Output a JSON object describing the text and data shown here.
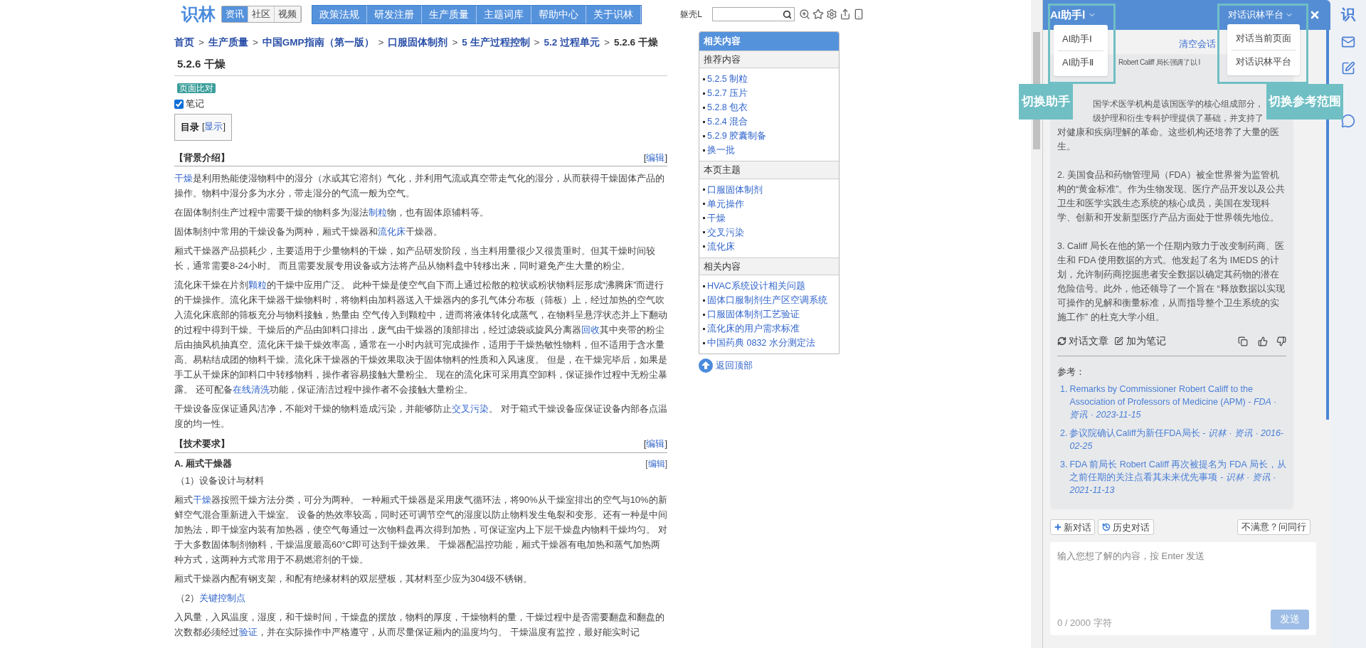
{
  "header": {
    "logo": "识林",
    "site_tabs": [
      {
        "label": "资讯",
        "selected": true
      },
      {
        "label": "社区",
        "selected": false
      },
      {
        "label": "视频",
        "selected": false
      }
    ],
    "nav_menu": [
      "政策法规",
      "研发注册",
      "生产质量",
      "主题词库",
      "帮助中心",
      "关于识林"
    ],
    "user": "躯壳L"
  },
  "breadcrumb": [
    {
      "kind": "link",
      "text": "首页"
    },
    {
      "kind": "sep",
      "text": ">"
    },
    {
      "kind": "link",
      "text": "生产质量"
    },
    {
      "kind": "sep",
      "text": ">"
    },
    {
      "kind": "link",
      "text": "中国GMP指南（第一版）"
    },
    {
      "kind": "sep",
      "text": ">"
    },
    {
      "kind": "link",
      "text": "口服固体制剂"
    },
    {
      "kind": "sep",
      "text": ">"
    },
    {
      "kind": "link",
      "text": "5 生产过程控制"
    },
    {
      "kind": "sep",
      "text": ">"
    },
    {
      "kind": "link",
      "text": "5.2 过程单元"
    },
    {
      "kind": "sep",
      "text": ">"
    },
    {
      "kind": "current",
      "text": "5.2.6 干燥"
    }
  ],
  "article": {
    "title": "5.2.6 干燥",
    "compare_badge": "页面比对",
    "note_checkbox": {
      "label": "笔记",
      "checked": true
    },
    "toc": {
      "title": "目录",
      "toggle": [
        {
          "kind": "text",
          "text": "["
        },
        {
          "kind": "link",
          "text": "显示"
        },
        {
          "kind": "text",
          "text": "]"
        }
      ]
    },
    "sections": [
      {
        "kind": "section",
        "title": "【背景介绍】",
        "edit": [
          {
            "kind": "text",
            "text": "["
          },
          {
            "kind": "link",
            "text": "编辑"
          },
          {
            "kind": "text",
            "text": "]"
          }
        ]
      },
      {
        "kind": "paragraph",
        "segments": [
          {
            "kind": "link",
            "text": "干燥"
          },
          {
            "kind": "text",
            "text": "是利用热能使湿物料中的湿分（水或其它溶剂）气化，并利用气流或真空带走气化的湿分，从而获得干燥固体产品的操作。物料中湿分多为水分，带走湿分的气流一般为空气。"
          }
        ]
      },
      {
        "kind": "paragraph",
        "segments": [
          {
            "kind": "text",
            "text": "在固体制剂生产过程中需要干燥的物料多为湿法"
          },
          {
            "kind": "link",
            "text": "制粒"
          },
          {
            "kind": "text",
            "text": "物，也有固体原辅料等。"
          }
        ]
      },
      {
        "kind": "paragraph",
        "segments": [
          {
            "kind": "text",
            "text": "固体制剂中常用的干燥设备为两种，厢式干燥器和"
          },
          {
            "kind": "link",
            "text": "流化床"
          },
          {
            "kind": "text",
            "text": "干燥器。"
          }
        ]
      },
      {
        "kind": "paragraph",
        "segments": [
          {
            "kind": "text",
            "text": "厢式干燥器产品损耗少，主要适用于少量物料的干燥，如产品研发阶段，当主料用量很少又很贵重时。但其干燥时间较长，通常需要8-24小时。 而且需要发展专用设备或方法将产品从物料盘中转移出来，同时避免产生大量的粉尘。"
          }
        ]
      },
      {
        "kind": "paragraph",
        "segments": [
          {
            "kind": "text",
            "text": "流化床干燥在片剂"
          },
          {
            "kind": "link",
            "text": "颗粒"
          },
          {
            "kind": "text",
            "text": "的干燥中应用广泛。 此种干燥是使空气自下而上通过松散的粒状或粉状物料层形成“沸腾床”而进行的干燥操作。流化床干燥器干燥物料时，将物料由加料器送入干燥器内的多孔气体分布板（筛板）上，经过加热的空气吹入流化床底部的筛板充分与物料接触，热量由 空气传入到颗粒中，进而将液体转化成蒸气，在物料呈悬浮状态并上下翻动的过程中得到干燥。干燥后的产品由卸料口排出，废气由干燥器的顶部排出，经过滤袋或旋风分离器"
          },
          {
            "kind": "link",
            "text": "回收"
          },
          {
            "kind": "text",
            "text": "其中夹带的粉尘后由抽风机抽真空。流化床干燥干燥效率高，通常在一小时内就可完成操作，适用于干燥热敏性物料，但不适用于含水量高、易粘结成团的物料干燥。流化床干燥器的干燥效果取决于固体物料的性质和入风速度。 但是，在干燥完毕后，如果是手工从干燥床的卸料口中转移物料，操作者容易接触大量粉尘。 现在的流化床可采用真空卸料，保证操作过程中无粉尘暴露。 还可配备"
          },
          {
            "kind": "link",
            "text": "在线清洗"
          },
          {
            "kind": "text",
            "text": "功能，保证清洁过程中操作者不会接触大量粉尘。"
          }
        ]
      },
      {
        "kind": "paragraph",
        "segments": [
          {
            "kind": "text",
            "text": "干燥设备应保证通风洁净，不能对干燥的物料造成污染，并能够防止"
          },
          {
            "kind": "link",
            "text": "交叉污染"
          },
          {
            "kind": "text",
            "text": "。 对于箱式干燥设备应保证设备内部各点温度的均一性。"
          }
        ]
      },
      {
        "kind": "section",
        "title": "【技术要求】",
        "edit": [
          {
            "kind": "text",
            "text": "["
          },
          {
            "kind": "link",
            "text": "编辑"
          },
          {
            "kind": "text",
            "text": "]"
          }
        ]
      },
      {
        "kind": "subsection",
        "title": "A. 厢式干燥器",
        "edit": [
          {
            "kind": "text",
            "text": "["
          },
          {
            "kind": "link",
            "text": "编辑"
          },
          {
            "kind": "text",
            "text": "]"
          }
        ]
      },
      {
        "kind": "item",
        "segments": [
          {
            "kind": "text",
            "text": "（1）设备设计与材料"
          }
        ]
      },
      {
        "kind": "paragraph",
        "segments": [
          {
            "kind": "text",
            "text": "厢式"
          },
          {
            "kind": "link",
            "text": "干燥"
          },
          {
            "kind": "text",
            "text": "器按照干燥方法分类，可分为两种。 一种厢式干燥器是采用废气循环法，将90%从干燥室排出的空气与10%的新鲜空气混合重新进入干燥室。 设备的热效率较高，同时还可调节空气的湿度以防止物料发生龟裂和变形。还有一种是中间加热法，即干燥室内装有加热器，使空气每通过一次物料盘再次得到加热，可保证室内上下层干燥盘内物料干燥均匀。 对于大多数固体制剂物料，干燥温度最高60°C即可达到干燥效果。 干燥器配温控功能，厢式干燥器有电加热和蒸气加热两种方式，这两种方式常用于不易燃溶剂的干燥。"
          }
        ]
      },
      {
        "kind": "paragraph",
        "segments": [
          {
            "kind": "text",
            "text": "厢式干燥器内配有钢支架，和配有绝缘材料的双层壁板，其材料至少应为304级不锈钢。"
          }
        ]
      },
      {
        "kind": "item",
        "segments": [
          {
            "kind": "text",
            "text": "（2）"
          },
          {
            "kind": "link",
            "text": "关键控制点"
          }
        ]
      },
      {
        "kind": "paragraph",
        "segments": [
          {
            "kind": "text",
            "text": "入风量，入风温度，湿度，和干燥时间，干燥盘的摆放，物料的厚度，干燥物料的量，干燥过程中是否需要翻盘和翻盘的次数都必须经过"
          },
          {
            "kind": "link",
            "text": "验证"
          },
          {
            "kind": "text",
            "text": "，并在实际操作中严格遵守，从而尽量保证厢内的温度均匀。 干燥温度有监控，最好能实时记"
          }
        ]
      }
    ]
  },
  "sidebar": {
    "title": "相关内容",
    "groups": [
      {
        "heading": "推荐内容",
        "items": [
          "5.2.5 制粒",
          "5.2.7 压片",
          "5.2.8 包衣",
          "5.2.4 混合",
          "5.2.9 胶囊制备",
          "换一批"
        ]
      },
      {
        "heading": "本页主题",
        "items": [
          "口服固体制剂",
          "单元操作",
          "干燥",
          "交叉污染",
          "流化床"
        ]
      },
      {
        "heading": "相关内容",
        "items": [
          "HVAC系统设计相关问题",
          "固体口服制剂生产区空调系统",
          "口服固体制剂工艺验证",
          "流化床的用户需求标准",
          "中国药典 0832 水分测定法"
        ]
      }
    ],
    "back_to_top": "返回顶部"
  },
  "chat": {
    "assistant_select": {
      "value": "AI助手Ⅰ",
      "options": [
        "AI助手Ⅰ",
        "AI助手Ⅱ"
      ]
    },
    "scope_select": {
      "value": "对话识林平台",
      "options": [
        "对话当前页面",
        "对话识林平台"
      ]
    },
    "clear": "清空会话",
    "annotations": [
      "切换助手",
      "切换参考范围"
    ],
    "partial_lines": [
      "Robert Califf 局长强调了以 I",
      "国学术医学机构是该国医学的核心组成部分，",
      "级护理和衍生专科护理提供了基础，并支持了"
    ],
    "paragraphs": [
      "对健康和疾病理解的革命。这些机构还培养了大量的医生。",
      "2. 美国食品和药物管理局（FDA）被全世界誉为监管机构的“黄金标准”。作为生物发现、医疗产品开发以及公共卫生和医学实践生态系统的核心成员，美国在发现科学、创新和开发新型医疗产品方面处于世界领先地位。",
      "3. Califf 局长在他的第一个任期内致力于改变制药商、医生和 FDA 使用数据的方式。他发起了名为 IMEDS 的计划，允许制药商挖掘患者安全数据以确定其药物的潜在危险信号。此外，他还领导了一个旨在 “释放数据以实现可操作的见解和衡量标准，从而指导整个卫生系统的实施工作” 的杜克大学小组。"
    ],
    "actions": [
      "对话文章",
      "加为笔记"
    ],
    "references_label": "参考：",
    "references": [
      {
        "number": "1.",
        "title": "Remarks by Commissioner Robert Califf to the Association of Professors of Medicine (APM)",
        "source": "- FDA · 资讯 · 2023-11-15"
      },
      {
        "number": "2.",
        "title": "参议院确认Califf为新任FDA局长",
        "source": "- 识林 · 资讯 · 2016-02-25"
      },
      {
        "number": "3.",
        "title": "FDA 前局长 Robert Califf 再次被提名为 FDA 局长，从之前任期的关注点看其未来优先事项",
        "source": "- 识林 · 资讯 · 2021-11-13"
      }
    ],
    "new_chat": "新对话",
    "history": "历史对话",
    "ask_peers": "不满意？问同行",
    "input": {
      "placeholder": "输入您想了解的内容，按 Enter 发送",
      "counter": "0 / 2000 字符"
    },
    "send": {
      "label": "发送",
      "disabled": true
    }
  },
  "right_rail": {
    "logo": "识"
  }
}
